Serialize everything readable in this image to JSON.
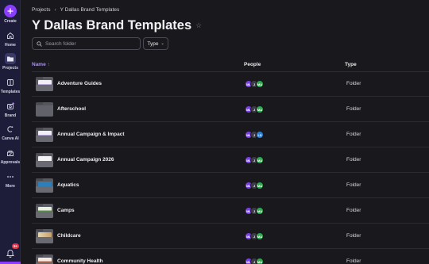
{
  "sidebar": {
    "create_label": "Create",
    "items": [
      {
        "label": "Home",
        "icon": "home-icon"
      },
      {
        "label": "Projects",
        "icon": "folder-icon"
      },
      {
        "label": "Templates",
        "icon": "templates-icon"
      },
      {
        "label": "Brand",
        "icon": "brand-icon"
      },
      {
        "label": "Canva AI",
        "icon": "canva-ai-icon"
      },
      {
        "label": "Approvals",
        "icon": "approvals-icon"
      },
      {
        "label": "More",
        "icon": "more-icon"
      }
    ],
    "notification_count": "9+"
  },
  "breadcrumb": {
    "root": "Projects",
    "current": "Y Dallas Brand Templates"
  },
  "page_title": "Y Dallas Brand Templates",
  "search": {
    "placeholder": "Search folder"
  },
  "filters": {
    "type_label": "Type"
  },
  "table": {
    "headers": {
      "name": "Name ↑",
      "people": "People",
      "type": "Type"
    },
    "rows": [
      {
        "name": "Adventure Guides",
        "type": "Folder",
        "thumb": "c-purple",
        "avatars": [
          "ML",
          "J",
          "MA"
        ]
      },
      {
        "name": "Afterschool",
        "type": "Folder",
        "thumb": "plain",
        "avatars": [
          "ML",
          "J",
          "MA"
        ]
      },
      {
        "name": "Annual Campaign & Impact",
        "type": "Folder",
        "thumb": "c-purple",
        "avatars": [
          "ML",
          "J",
          "LS"
        ]
      },
      {
        "name": "Annual Campaign 2026",
        "type": "Folder",
        "thumb": "c-red",
        "avatars": [
          "ML",
          "J",
          "MA"
        ]
      },
      {
        "name": "Aquatics",
        "type": "Folder",
        "thumb": "c-blue",
        "avatars": [
          "ML",
          "J",
          "MA"
        ]
      },
      {
        "name": "Camps",
        "type": "Folder",
        "thumb": "c-green",
        "avatars": [
          "ML",
          "J",
          "MA"
        ]
      },
      {
        "name": "Childcare",
        "type": "Folder",
        "thumb": "c-kids",
        "avatars": [
          "ML",
          "J",
          "MA"
        ]
      },
      {
        "name": "Community Health",
        "type": "Folder",
        "thumb": "c-warm",
        "avatars": [
          "ML",
          "J",
          "MA"
        ]
      }
    ]
  },
  "colors": {
    "accent": "#8b3dff",
    "avatar_ml": "#7b3fe4",
    "avatar_j": "#3b3b44",
    "avatar_ma": "#2fa84f",
    "avatar_ls": "#2f7fd0"
  }
}
